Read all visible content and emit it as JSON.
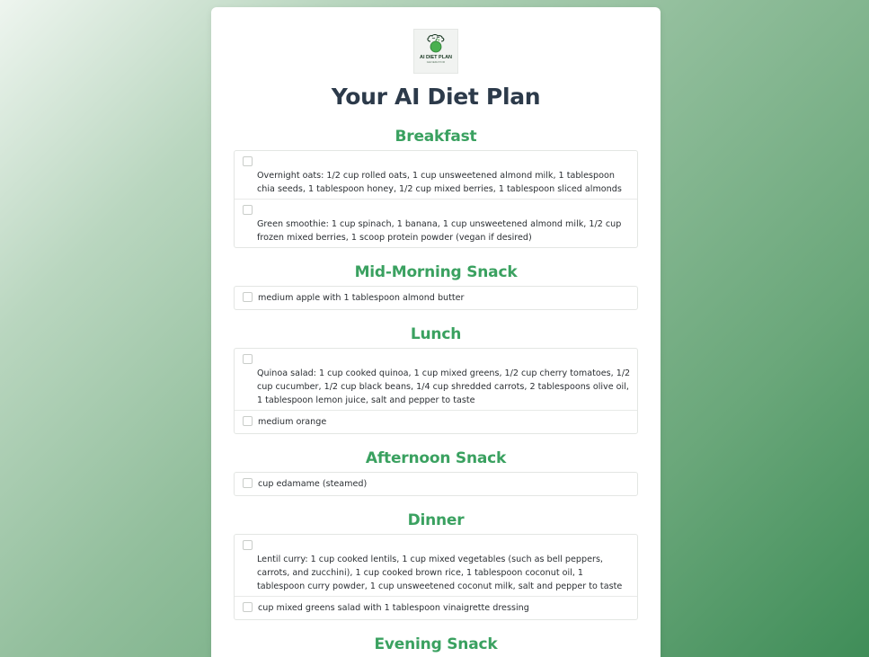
{
  "logo": {
    "title": "AI DIET PLAN",
    "subtitle": "GENERATOR",
    "icon": "brain-apple-icon"
  },
  "page_title": "Your AI Diet Plan",
  "sections": [
    {
      "title": "Breakfast",
      "items": [
        "Overnight oats: 1/2 cup rolled oats, 1 cup unsweetened almond milk, 1 tablespoon chia seeds, 1 tablespoon honey, 1/2 cup mixed berries, 1 tablespoon sliced almonds",
        "Green smoothie: 1 cup spinach, 1 banana, 1 cup unsweetened almond milk, 1/2 cup frozen mixed berries, 1 scoop protein powder (vegan if desired)"
      ]
    },
    {
      "title": "Mid-Morning Snack",
      "items": [
        "medium apple with 1 tablespoon almond butter"
      ]
    },
    {
      "title": "Lunch",
      "items": [
        "Quinoa salad: 1 cup cooked quinoa, 1 cup mixed greens, 1/2 cup cherry tomatoes, 1/2 cup cucumber, 1/2 cup black beans, 1/4 cup shredded carrots, 2 tablespoons olive oil, 1 tablespoon lemon juice, salt and pepper to taste",
        "medium orange"
      ]
    },
    {
      "title": "Afternoon Snack",
      "items": [
        "cup edamame (steamed)"
      ]
    },
    {
      "title": "Dinner",
      "items": [
        "Lentil curry: 1 cup cooked lentils, 1 cup mixed vegetables (such as bell peppers, carrots, and zucchini), 1 cup cooked brown rice, 1 tablespoon coconut oil, 1 tablespoon curry powder, 1 cup unsweetened coconut milk, salt and pepper to taste",
        "cup mixed greens salad with 1 tablespoon vinaigrette dressing"
      ]
    },
    {
      "title": "Evening Snack",
      "items": []
    }
  ]
}
